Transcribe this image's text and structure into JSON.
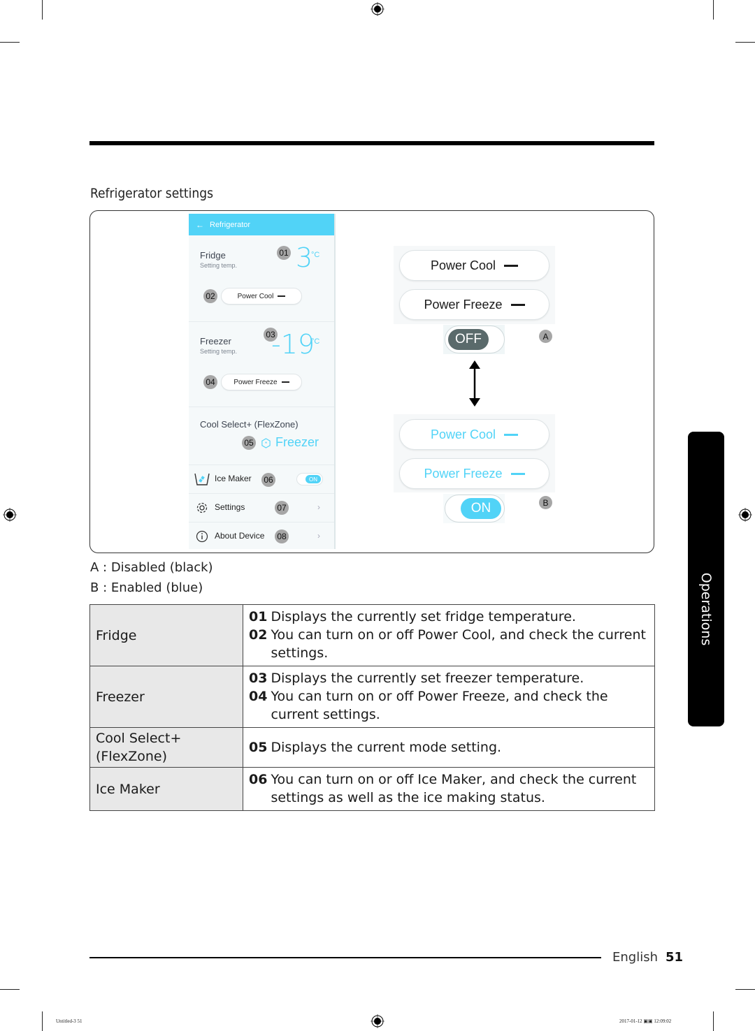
{
  "section_title": "Refrigerator settings",
  "app": {
    "header_title": "Refrigerator",
    "fridge": {
      "label": "Fridge",
      "sub": "Setting temp.",
      "temp": "3",
      "unit": "°C",
      "badge": "01",
      "button": "Power Cool",
      "button_badge": "02"
    },
    "freezer": {
      "label": "Freezer",
      "sub": "Setting temp.",
      "temp": "-19",
      "unit": "°C",
      "badge": "03",
      "button": "Power Freeze",
      "button_badge": "04"
    },
    "flexzone": {
      "label": "Cool Select+ (FlexZone)",
      "mode": "Freezer",
      "badge": "05"
    },
    "rows": [
      {
        "label": "Ice Maker",
        "badge": "06",
        "toggle": "ON"
      },
      {
        "label": "Settings",
        "badge": "07"
      },
      {
        "label": "About Device",
        "badge": "08"
      }
    ]
  },
  "states": {
    "disabled": {
      "power_cool": "Power Cool",
      "power_freeze": "Power Freeze",
      "toggle": "OFF",
      "marker": "A"
    },
    "enabled": {
      "power_cool": "Power Cool",
      "power_freeze": "Power Freeze",
      "toggle": "ON",
      "marker": "B"
    }
  },
  "legend": {
    "a": "A : Disabled (black)",
    "b": "B : Enabled (blue)"
  },
  "table": [
    {
      "name": "Fridge",
      "items": [
        {
          "num": "01",
          "text": "Displays the currently set fridge temperature."
        },
        {
          "num": "02",
          "text": "You can turn on or off Power Cool, and check the current settings."
        }
      ]
    },
    {
      "name": "Freezer",
      "items": [
        {
          "num": "03",
          "text": "Displays the currently set freezer temperature."
        },
        {
          "num": "04",
          "text": "You can turn on or off Power Freeze, and check the current settings."
        }
      ]
    },
    {
      "name": "Cool Select+ (FlexZone)",
      "items": [
        {
          "num": "05",
          "text": "Displays the current mode setting."
        }
      ]
    },
    {
      "name": "Ice Maker",
      "items": [
        {
          "num": "06",
          "text": "You can turn on or off Ice Maker, and check the current settings as well as the ice making status."
        }
      ]
    }
  ],
  "side_tab": "Operations",
  "footer": {
    "language": "English",
    "page": "51"
  },
  "print_info": {
    "left": "Untitled-3   51",
    "right": "2017-01-12   ▣▣ 12:09:02"
  },
  "colors": {
    "accent": "#51d3f7",
    "disabled_knob": "#5a6a6b",
    "badge": "#a6a6a6"
  }
}
